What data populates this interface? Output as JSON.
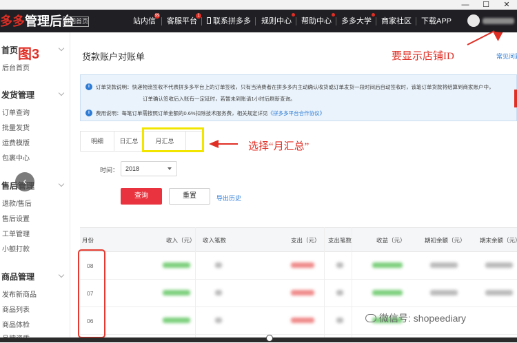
{
  "window": {
    "minimize": "—",
    "maximize": "☐",
    "close": "✕"
  },
  "header": {
    "logo_brand": "多多",
    "logo_text": "管理后台",
    "back_home": "返回首页",
    "nav": [
      {
        "label": "站内信",
        "badge": "99"
      },
      {
        "label": "客服平台",
        "badge": "1"
      },
      {
        "label": "联系拼多多"
      },
      {
        "label": "规则中心",
        "badge": ""
      },
      {
        "label": "帮助中心",
        "badge": ""
      },
      {
        "label": "多多大学",
        "badge": ""
      },
      {
        "label": "商家社区"
      },
      {
        "label": "下载APP"
      }
    ]
  },
  "sidebar": {
    "sections": [
      {
        "title": "首页",
        "items": [
          "后台首页"
        ]
      },
      {
        "title": "发货管理",
        "items": [
          "订单查询",
          "批量发货",
          "运费模版",
          "包裹中心"
        ]
      },
      {
        "title": "售后管理",
        "items": [
          "退款/售后",
          "售后设置",
          "工单管理",
          "小额打款"
        ]
      },
      {
        "title": "商品管理",
        "items": [
          "发布新商品",
          "商品列表",
          "商品体检",
          "品牌资质"
        ]
      }
    ],
    "collapse_icon": "‹"
  },
  "main": {
    "title": "货款账户对账单",
    "help_link": "常见问题",
    "notices": [
      {
        "label": "订单货款说明：",
        "text": "快递物流签收不代表拼多多平台上的订单签收，只有当消费者在拼多多内主动确认收货或订单发货一段时间后自动签收时，该笔订单货款将结算到商家账户中，"
      },
      {
        "label": "",
        "text": "订单确认签收后入账有一定延时，若暂未到账请1小时后刷新查询。"
      },
      {
        "label": "费用说明：",
        "text": "每笔订单需按照订单金额的0.6%扣除技术服务费，相关规定详见",
        "link": "《拼多多平台合作协议》"
      }
    ],
    "tabs": [
      "明细",
      "日汇总",
      "月汇总"
    ],
    "filter": {
      "label": "时间：",
      "year": "2018"
    },
    "buttons": {
      "query": "查询",
      "reset": "重置",
      "export": "导出历史"
    },
    "table": {
      "headers": [
        "月份",
        "收入（元）",
        "收入笔数",
        "支出（元）",
        "支出笔数",
        "收益（元）",
        "期初余额（元）",
        "期末余额（元）"
      ],
      "rows": [
        {
          "month": "08"
        },
        {
          "month": "07"
        },
        {
          "month": "06"
        }
      ]
    }
  },
  "annotations": {
    "figure_label": "图3",
    "shop_id_note": "要显示店铺ID",
    "tab_note": "选择“月汇总”"
  },
  "watermark": "微信号: shopeediary",
  "colors": {
    "accent": "#e02e24",
    "link": "#2e7cd6",
    "highlight": "#f2e600"
  }
}
